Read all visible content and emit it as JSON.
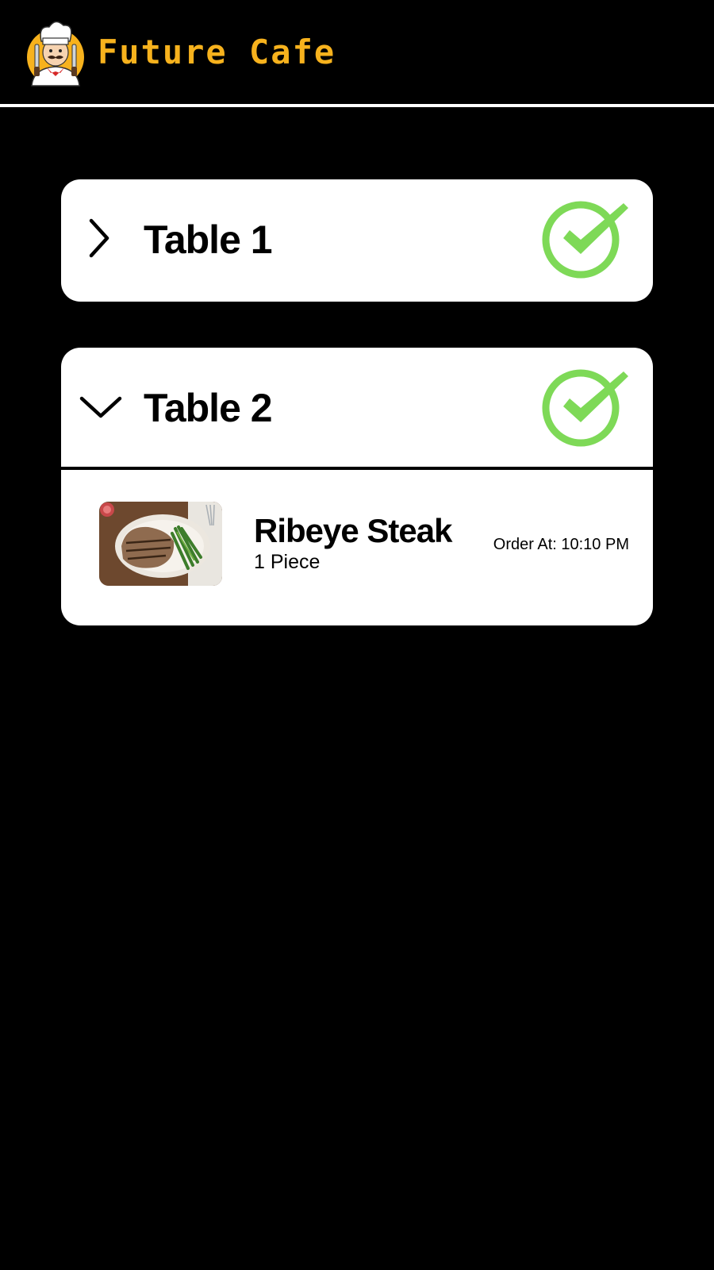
{
  "app": {
    "brand_name": "Future Cafe",
    "brand_color": "#f7b21d",
    "logo_icon": "chef-mascot-logo"
  },
  "colors": {
    "background": "#000000",
    "card": "#ffffff",
    "check_green": "#7ed957"
  },
  "tables": [
    {
      "label": "Table 1",
      "expanded": false,
      "toggle_icon": "chevron-right-icon",
      "status_icon": "check-circle-icon"
    },
    {
      "label": "Table 2",
      "expanded": true,
      "toggle_icon": "chevron-down-icon",
      "status_icon": "check-circle-icon",
      "items": [
        {
          "name": "Ribeye Steak",
          "quantity": "1 Piece",
          "order_time": "Order At: 10:10 PM",
          "image_icon": "steak-photo"
        }
      ]
    }
  ]
}
